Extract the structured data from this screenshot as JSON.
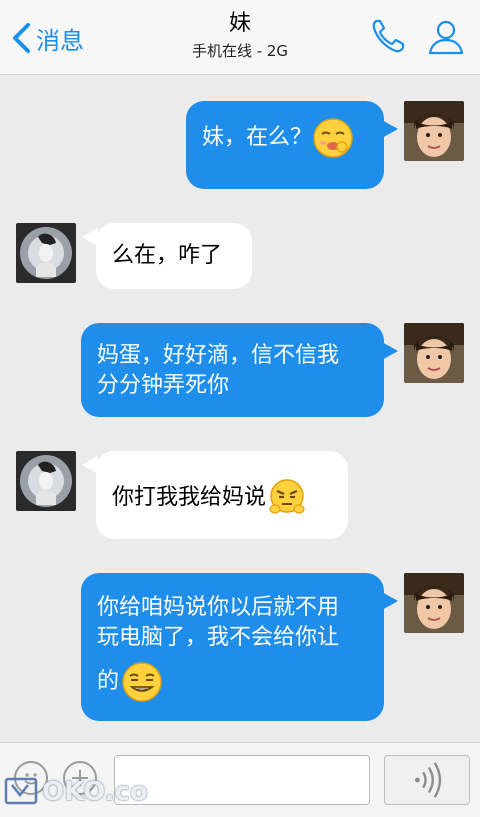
{
  "header": {
    "back_label": "消息",
    "title": "妹",
    "subtitle": "手机在线 - 2G"
  },
  "messages": [
    {
      "direction": "out",
      "text": "妹，在么？",
      "emoji": "sly-smile-emoji"
    },
    {
      "direction": "in",
      "text": "么在，咋了",
      "emoji": null
    },
    {
      "direction": "out",
      "lines": [
        "妈蛋，好好滴，信不信我",
        "分分钟弄死你"
      ],
      "emoji": null
    },
    {
      "direction": "in",
      "text": "你打我我给妈说",
      "emoji": "annoyed-emoji"
    },
    {
      "direction": "out",
      "lines": [
        "你给咱妈说你以后就不用",
        "玩电脑了，我不会给你让",
        "的"
      ],
      "emoji": "grin-emoji"
    }
  ],
  "watermark": "OKO.co",
  "colors": {
    "accent": "#1a8fe8",
    "outgoing_bubble": "#1e8eea",
    "incoming_bubble": "#ffffff",
    "background": "#ebebeb"
  }
}
